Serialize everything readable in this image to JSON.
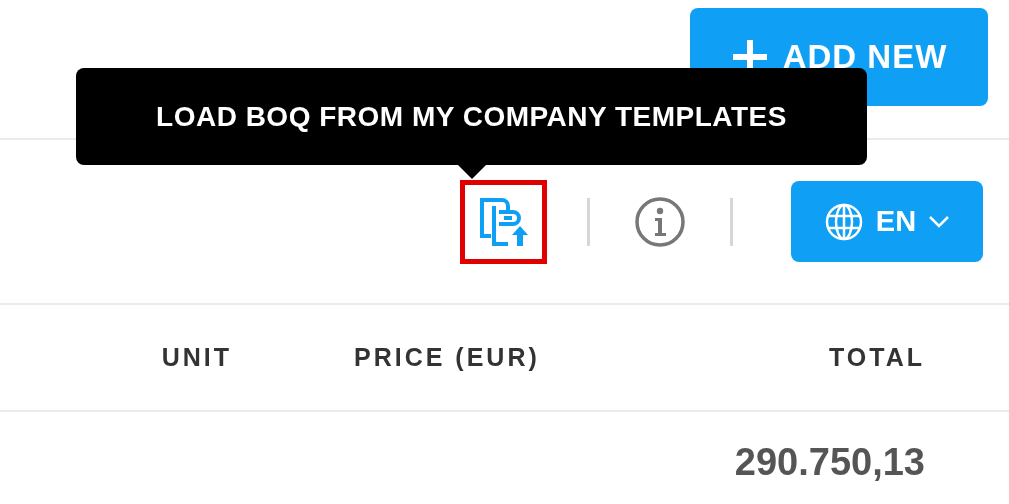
{
  "header": {
    "add_button": {
      "label": "ADD NEW"
    }
  },
  "toolbar": {
    "tooltip": "LOAD BOQ FROM MY COMPANY TEMPLATES",
    "template_button": {
      "highlighted": true
    },
    "language_button": {
      "label": "EN"
    }
  },
  "table": {
    "columns": [
      "UNIT",
      "PRICE (EUR)",
      "TOTAL"
    ],
    "rows": [
      {
        "total": "290.750,13"
      }
    ]
  }
}
